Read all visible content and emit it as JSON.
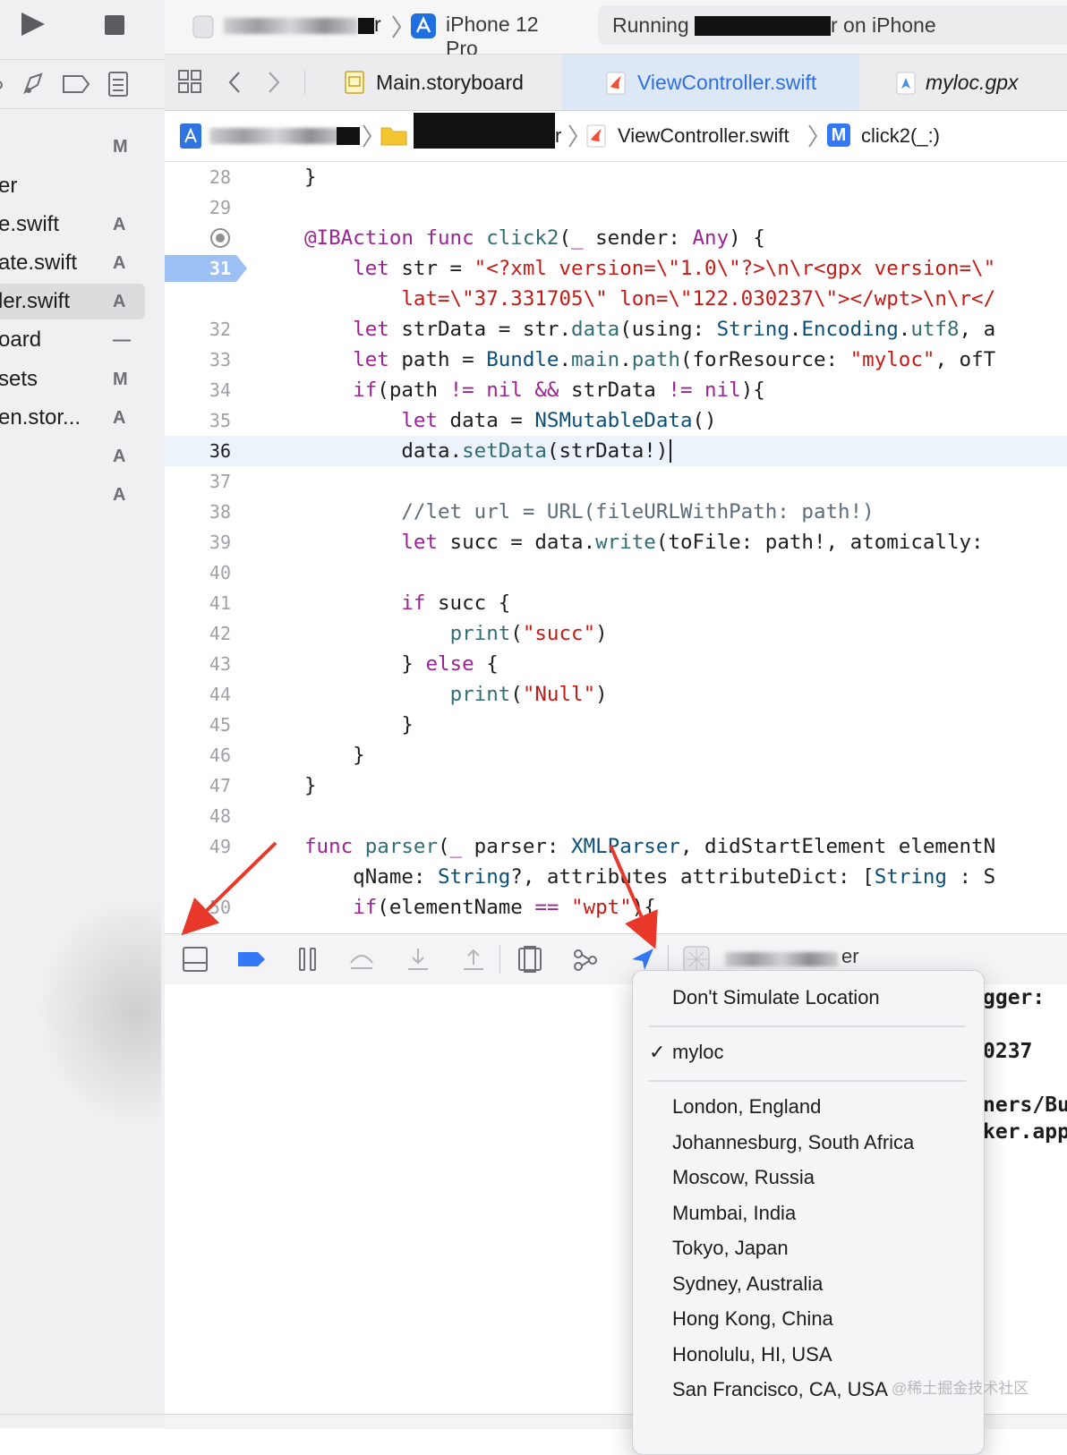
{
  "toolbar": {
    "device": "iPhone 12 Pro",
    "status_prefix": "Running",
    "status_suffix": "r on iPhone",
    "scheme_suffix": "r"
  },
  "sidebar": {
    "files": [
      {
        "name": "",
        "status": "M"
      },
      {
        "name": "er",
        "status": ""
      },
      {
        "name": "e.swift",
        "status": "A"
      },
      {
        "name": "ate.swift",
        "status": "A"
      },
      {
        "name": "ler.swift",
        "status": "A"
      },
      {
        "name": "oard",
        "status": "—"
      },
      {
        "name": "sets",
        "status": "M"
      },
      {
        "name": "en.stor...",
        "status": "A"
      },
      {
        "name": "",
        "status": "A"
      },
      {
        "name": "",
        "status": "A"
      }
    ]
  },
  "tabs": [
    {
      "label": "Main.storyboard"
    },
    {
      "label": "ViewController.swift"
    },
    {
      "label": "myloc.gpx"
    }
  ],
  "jumpbar": {
    "folder_suffix": "r",
    "file": "ViewController.swift",
    "method_badge": "M",
    "method": "click2(_:)"
  },
  "editor": {
    "line_numbers": [
      "28",
      "29",
      "",
      "31",
      "",
      "32",
      "33",
      "34",
      "35",
      "36",
      "37",
      "38",
      "39",
      "40",
      "41",
      "42",
      "43",
      "44",
      "45",
      "46",
      "47",
      "48",
      "49",
      "",
      "50"
    ],
    "current_line": "36",
    "breakpoint_line": "31"
  },
  "debug": {
    "target_suffix": "er"
  },
  "console": {
    "lines": [
      "gger: ",
      "0237",
      "ners/Bu",
      "ker.app"
    ]
  },
  "location_menu": {
    "none_option": "Don't Simulate Location",
    "checkmark": "✓",
    "selected": "myloc",
    "cities": [
      "London, England",
      "Johannesburg, South Africa",
      "Moscow, Russia",
      "Mumbai, India",
      "Tokyo, Japan",
      "Sydney, Australia",
      "Hong Kong, China",
      "Honolulu, HI, USA",
      "San Francisco, CA, USA"
    ]
  },
  "watermark": "@稀土掘金技术社区",
  "colors": {
    "accent": "#3478f6",
    "breakpoint": "#9cc0f3",
    "annotation_arrow": "#e8382a"
  }
}
